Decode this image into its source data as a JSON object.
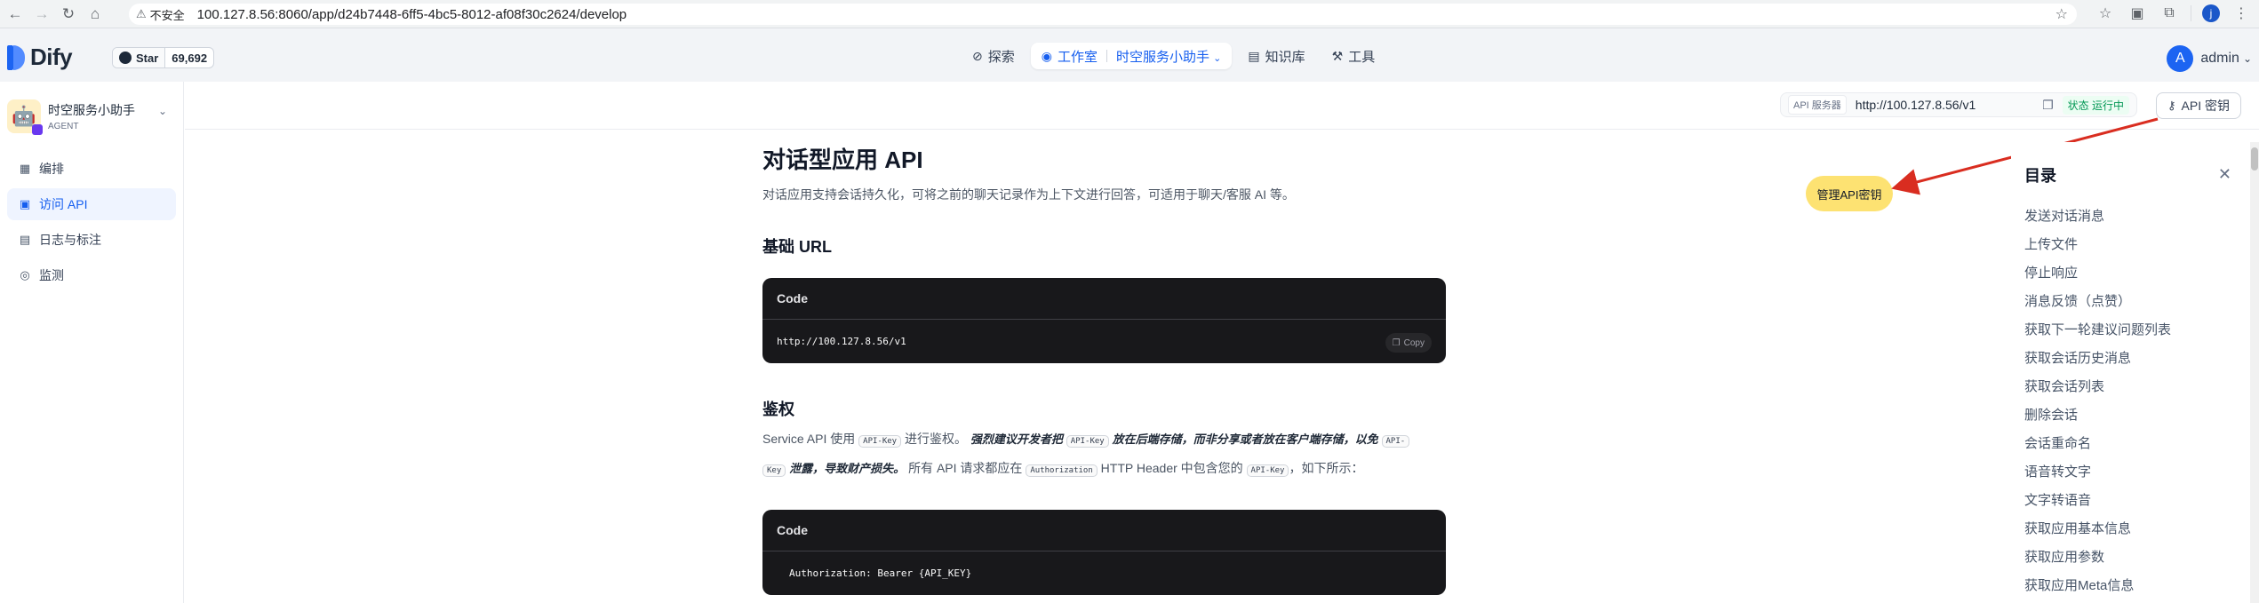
{
  "browser": {
    "insecure_label": "不安全",
    "url": "100.127.8.56:8060/app/d24b7448-6ff5-4bc5-8012-af08f30c2624/develop",
    "profile_initial": "j"
  },
  "header": {
    "logo": "Dify",
    "github_star_label": "Star",
    "github_star_count": "69,692",
    "nav": {
      "explore": "探索",
      "studio": "工作室",
      "current_app": "时空服务小助手",
      "knowledge": "知识库",
      "tools": "工具"
    },
    "user_initial": "A",
    "user_name": "admin"
  },
  "sidebar": {
    "app_name": "时空服务小助手",
    "app_type": "AGENT",
    "items": [
      {
        "label": "编排",
        "icon": "layout-icon"
      },
      {
        "label": "访问 API",
        "icon": "terminal-icon",
        "active": true
      },
      {
        "label": "日志与标注",
        "icon": "file-text-icon"
      },
      {
        "label": "监测",
        "icon": "monitor-icon"
      }
    ]
  },
  "api_bar": {
    "server_label": "API 服务器",
    "server_url": "http://100.127.8.56/v1",
    "status": "状态 运行中",
    "api_key_button": "API 密钥"
  },
  "annotation": {
    "label": "管理API密钥",
    "color": "#fde272",
    "arrow_color": "#d92d20"
  },
  "doc": {
    "title": "对话型应用 API",
    "description": "对话应用支持会话持久化，可将之前的聊天记录作为上下文进行回答，可适用于聊天/客服 AI 等。",
    "base_url_heading": "基础 URL",
    "code_label": "Code",
    "base_url_code": "http://100.127.8.56/v1",
    "copy_label": "Copy",
    "auth_heading": "鉴权",
    "auth_p1": "Service API 使用",
    "auth_kbd": "API-Key",
    "auth_p2": "进行鉴权。",
    "auth_em": "强烈建议开发者把",
    "auth_em2": "放在后端存储，而非分享或者放在客户端存储，以免",
    "auth_kbd_tail": "API-",
    "auth_kbd_head": "Key",
    "auth_em3": "泄露，导致财产损失。",
    "auth_p3": "所有 API 请求都应在",
    "auth_kbd2": "Authorization",
    "auth_p4": "HTTP Header 中包含您的",
    "auth_p5": "，如下所示：",
    "auth_code": "Authorization: Bearer {API_KEY}"
  },
  "toc": {
    "title": "目录",
    "items": [
      "发送对话消息",
      "上传文件",
      "停止响应",
      "消息反馈（点赞）",
      "获取下一轮建议问题列表",
      "获取会话历史消息",
      "获取会话列表",
      "删除会话",
      "会话重命名",
      "语音转文字",
      "文字转语音",
      "获取应用基本信息",
      "获取应用参数",
      "获取应用Meta信息"
    ]
  }
}
